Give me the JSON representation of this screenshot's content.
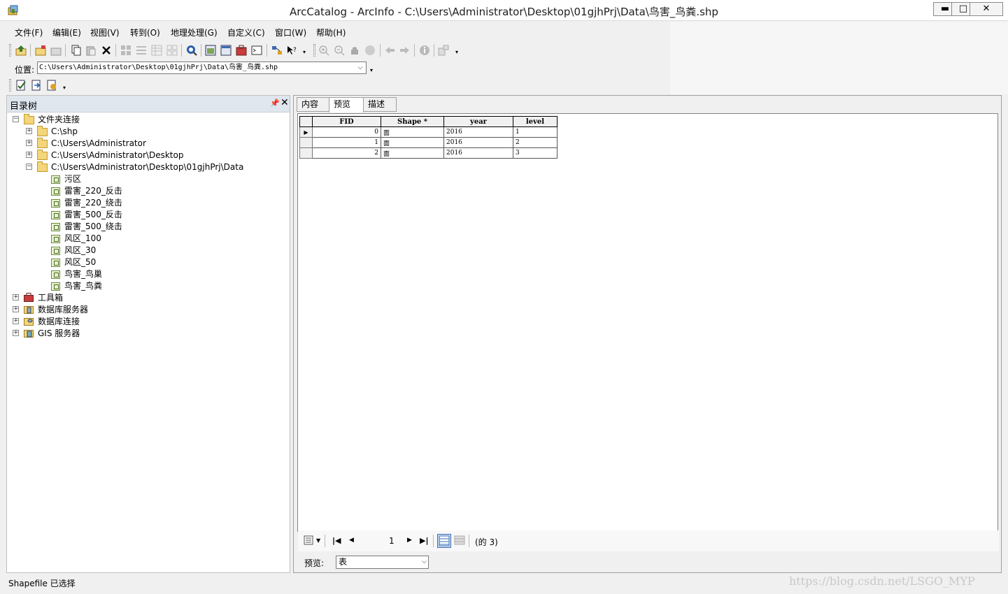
{
  "window": {
    "title": "ArcCatalog - ArcInfo - C:\\Users\\Administrator\\Desktop\\01gjhPrj\\Data\\鸟害_鸟粪.shp",
    "minimize": "▬",
    "maximize": "□",
    "close": "✕"
  },
  "menu": [
    "文件(F)",
    "编辑(E)",
    "视图(V)",
    "转到(O)",
    "地理处理(G)",
    "自定义(C)",
    "窗口(W)",
    "帮助(H)"
  ],
  "location": {
    "label": "位置:",
    "value": "C:\\Users\\Administrator\\Desktop\\01gjhPrj\\Data\\鸟害_鸟粪.shp"
  },
  "tree": {
    "title": "目录树",
    "nodes": {
      "folder_connections": "文件夹连接",
      "c_shp": "C:\\shp",
      "admin": "C:\\Users\\Administrator",
      "desktop": "C:\\Users\\Administrator\\Desktop",
      "data": "C:\\Users\\Administrator\\Desktop\\01gjhPrj\\Data",
      "f1": "污区",
      "f2": "雷害_220_反击",
      "f3": "雷害_220_绕击",
      "f4": "雷害_500_反击",
      "f5": "雷害_500_绕击",
      "f6": "风区_100",
      "f7": "风区_30",
      "f8": "风区_50",
      "f9": "鸟害_鸟巢",
      "f10": "鸟害_鸟粪",
      "toolbox": "工具箱",
      "db_servers": "数据库服务器",
      "db_connections": "数据库连接",
      "gis_servers": "GIS 服务器"
    }
  },
  "tabs": {
    "contents": "内容",
    "preview": "预览",
    "description": "描述"
  },
  "table": {
    "headers": [
      "FID",
      "Shape *",
      "year",
      "level"
    ],
    "rows": [
      {
        "fid": "0",
        "shape": "面",
        "year": "2016",
        "level": "1"
      },
      {
        "fid": "1",
        "shape": "面",
        "year": "2016",
        "level": "2"
      },
      {
        "fid": "2",
        "shape": "面",
        "year": "2016",
        "level": "3"
      }
    ]
  },
  "navigation": {
    "current_record": "1",
    "total": "(的 3)"
  },
  "preview_control": {
    "label": "预览:",
    "selected": "表"
  },
  "status": "Shapefile 已选择",
  "watermark": "https://blog.csdn.net/LSGO_MYP"
}
